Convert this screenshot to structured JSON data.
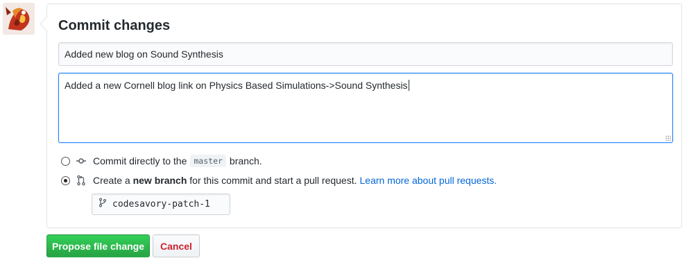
{
  "commit_form": {
    "title": "Commit changes",
    "summary_value": "Added new blog on Sound Synthesis",
    "description_value": "Added a new Cornell blog link on Physics Based Simulations->Sound Synthesis",
    "option_direct": {
      "prefix": "Commit directly to the",
      "branch_code": "master",
      "suffix": "branch.",
      "selected": false
    },
    "option_new_branch": {
      "prefix": "Create a",
      "bold": "new branch",
      "suffix": "for this commit and start a pull request.",
      "link": "Learn more about pull requests.",
      "selected": true
    },
    "new_branch_name": "codesavory-patch-1",
    "propose_button": "Propose file change",
    "cancel_button": "Cancel"
  },
  "icons": {
    "direct_commit": "git-commit-icon",
    "pull_request": "git-pull-request-icon",
    "branch": "git-branch-icon",
    "avatar": "user-avatar"
  },
  "colors": {
    "primary_green": "#28a745",
    "cancel_red": "#cb2431",
    "link_blue": "#0366d6",
    "focus_blue": "#2188ff"
  }
}
